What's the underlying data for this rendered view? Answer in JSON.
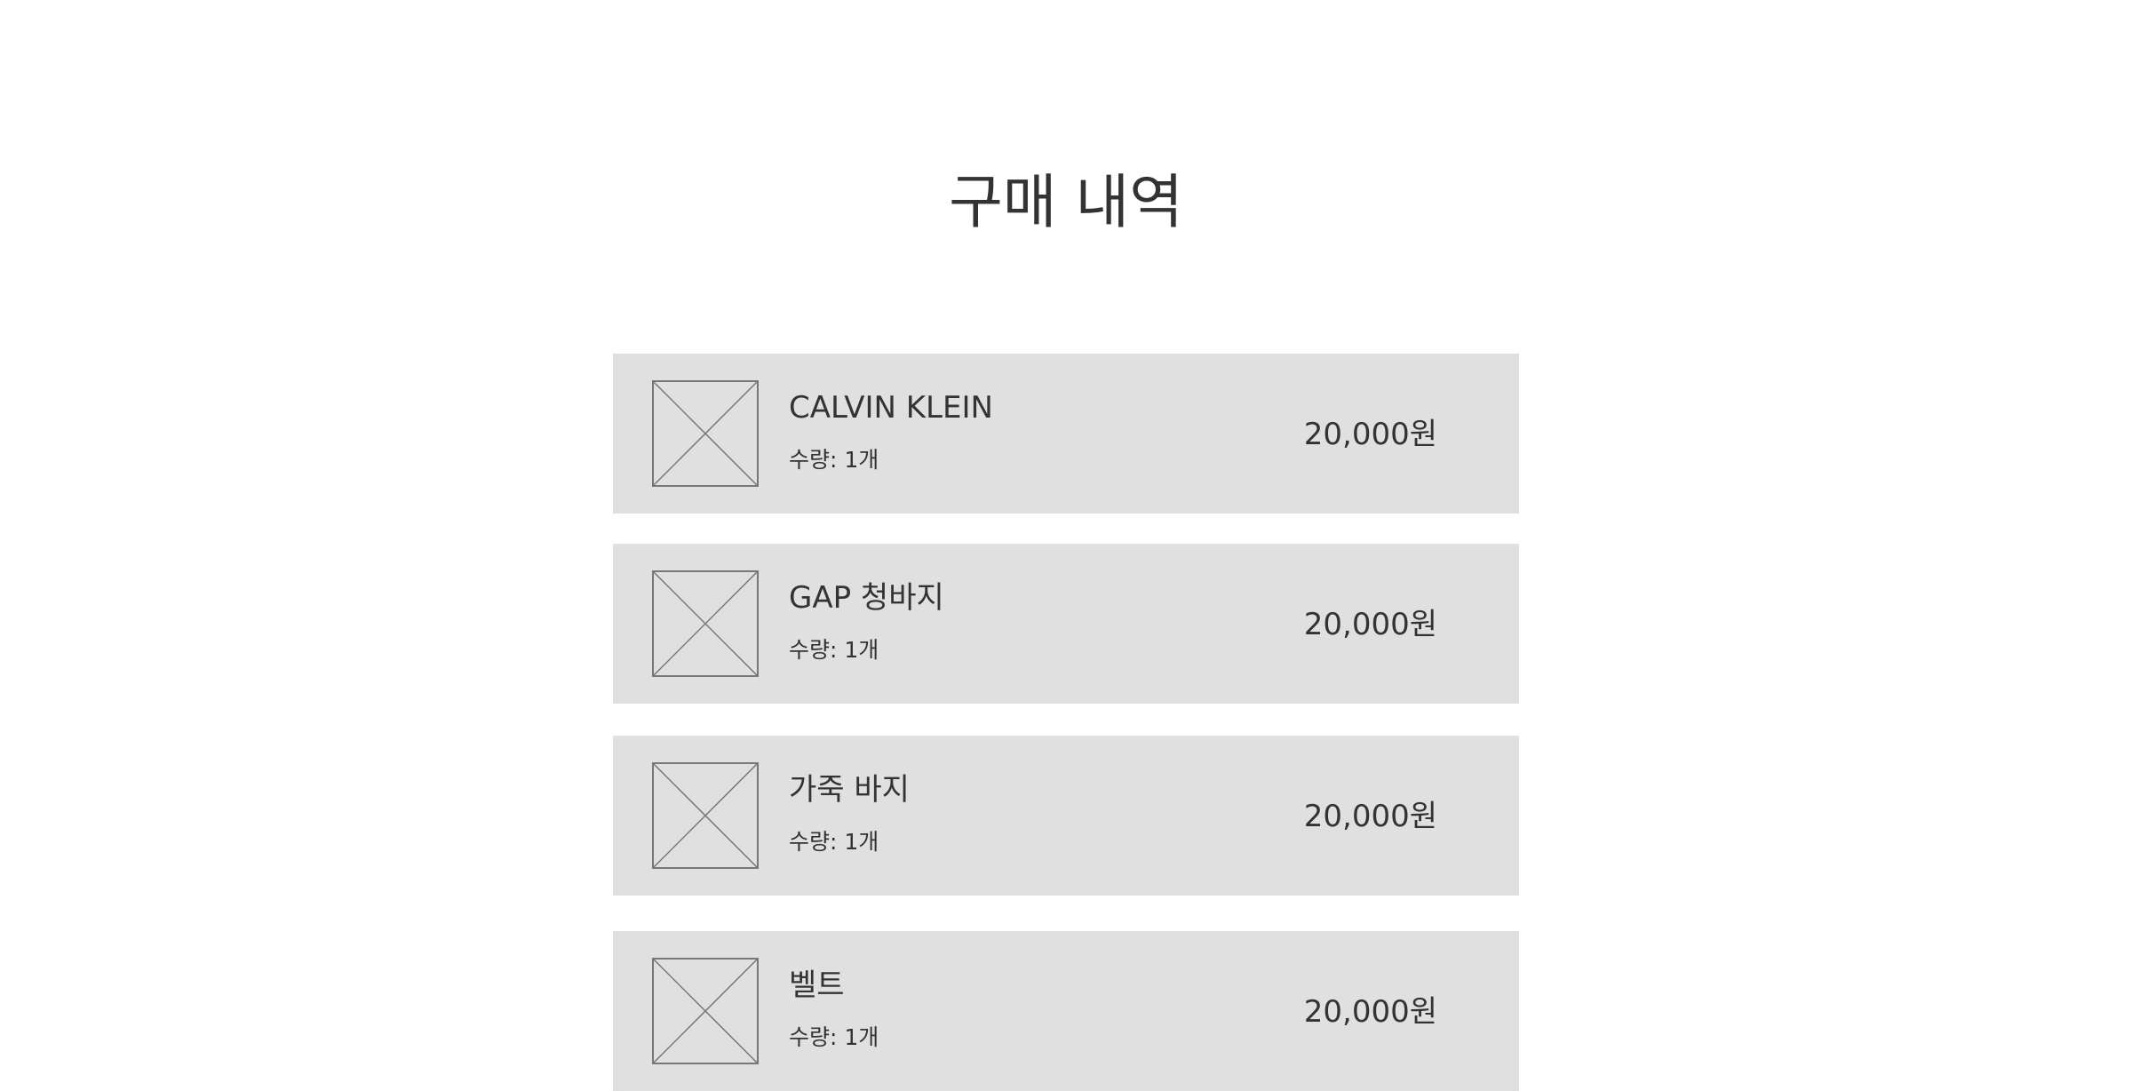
{
  "page": {
    "title": "구매 내역"
  },
  "orders": [
    {
      "name": "CALVIN KLEIN",
      "quantity": "수량: 1개",
      "price": "20,000원",
      "image": "image-placeholder-icon"
    },
    {
      "name": "GAP 청바지",
      "quantity": "수량: 1개",
      "price": "20,000원",
      "image": "image-placeholder-icon"
    },
    {
      "name": "가죽 바지",
      "quantity": "수량: 1개",
      "price": "20,000원",
      "image": "image-placeholder-icon"
    },
    {
      "name": "벨트",
      "quantity": "수량: 1개",
      "price": "20,000원",
      "image": "image-placeholder-icon"
    }
  ],
  "colors": {
    "text": "#333333",
    "card_background": "#e0e0e0",
    "placeholder_stroke": "#777777"
  }
}
